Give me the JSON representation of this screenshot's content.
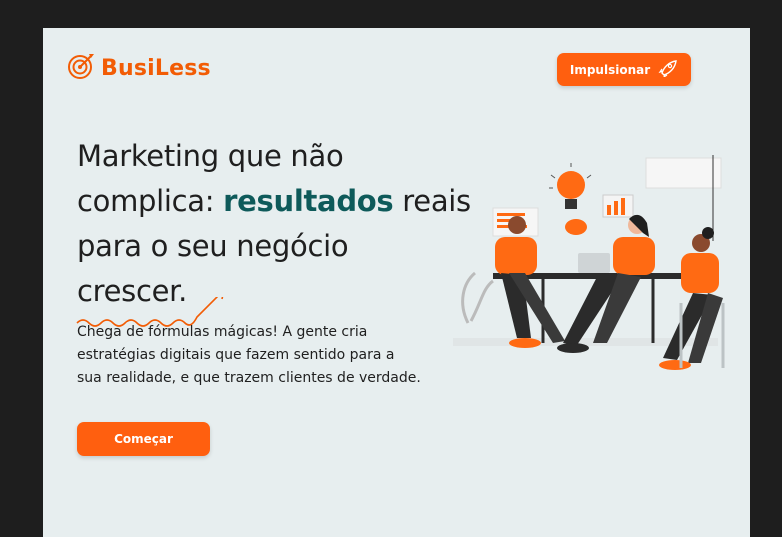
{
  "brand": {
    "name": "BusiLess",
    "logo_icon": "target-icon"
  },
  "header": {
    "cta_label": "Impulsionar",
    "cta_icon": "rocket-icon"
  },
  "hero": {
    "line1": "Marketing que não",
    "line2_pre": "complica: ",
    "line2_highlight": "resultados",
    "line2_post": " reais",
    "line3": "para o seu negócio",
    "line4": "crescer.",
    "description": "Chega de fórmulas mágicas! A gente cria estratégias digitais que fazem sentido para a sua realidade, e que trazem clientes de verdade.",
    "cta_label": "Começar"
  },
  "colors": {
    "accent": "#ff5f0f",
    "highlight": "#0e5a5a",
    "background": "#e7eeef"
  }
}
